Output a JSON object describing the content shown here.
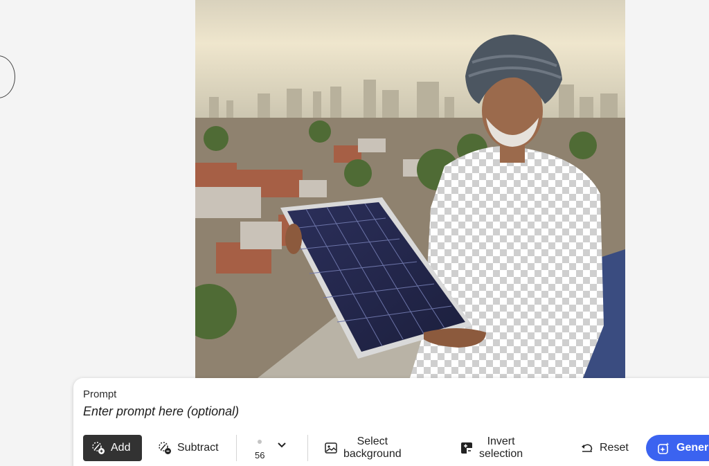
{
  "prompt": {
    "label": "Prompt",
    "placeholder": "Enter prompt here (optional)"
  },
  "toolbar": {
    "add_label": "Add",
    "subtract_label": "Subtract",
    "brush_size": "56",
    "select_background_label": "Select background",
    "invert_selection_label": "Invert selection",
    "reset_label": "Reset",
    "generate_label": "Gener"
  },
  "icons": {
    "add": "brush-add-icon",
    "subtract": "brush-subtract-icon",
    "brush_dropdown": "chevron-down-icon",
    "select_background": "image-icon",
    "invert_selection": "invert-icon",
    "reset": "undo-icon",
    "generate": "sparkle-icon"
  },
  "colors": {
    "accent": "#3b63f0",
    "active_tool": "#323232",
    "background": "#f4f4f4"
  }
}
